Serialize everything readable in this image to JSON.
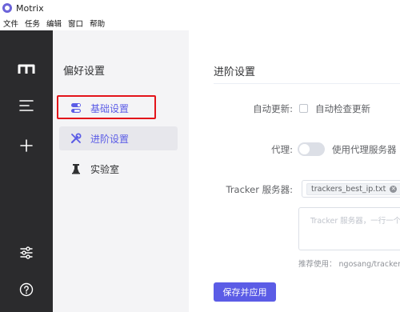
{
  "window": {
    "title": "Motrix"
  },
  "menubar": {
    "items": [
      "文件",
      "任务",
      "编辑",
      "窗口",
      "帮助"
    ]
  },
  "subnav": {
    "title": "偏好设置",
    "items": [
      {
        "label": "基础设置",
        "icon": "toggle-icon"
      },
      {
        "label": "进阶设置",
        "icon": "wrench-screwdriver-icon"
      },
      {
        "label": "实验室",
        "icon": "flask-icon"
      }
    ]
  },
  "main": {
    "title": "进阶设置",
    "auto_update": {
      "label": "自动更新:",
      "checkbox_label": "自动检查更新",
      "checked": false
    },
    "proxy": {
      "label": "代理:",
      "switch_label": "使用代理服务器",
      "enabled": false
    },
    "tracker": {
      "label": "Tracker 服务器:",
      "tag": "trackers_best_ip.txt",
      "placeholder": "Tracker 服务器，一行一个",
      "hint": "推荐使用：  ngosang/tracker"
    },
    "save_label": "保存并应用"
  },
  "colors": {
    "accent": "#5b5ce6",
    "sidebar": "#2b2b2d",
    "highlight": "#e3141a"
  }
}
